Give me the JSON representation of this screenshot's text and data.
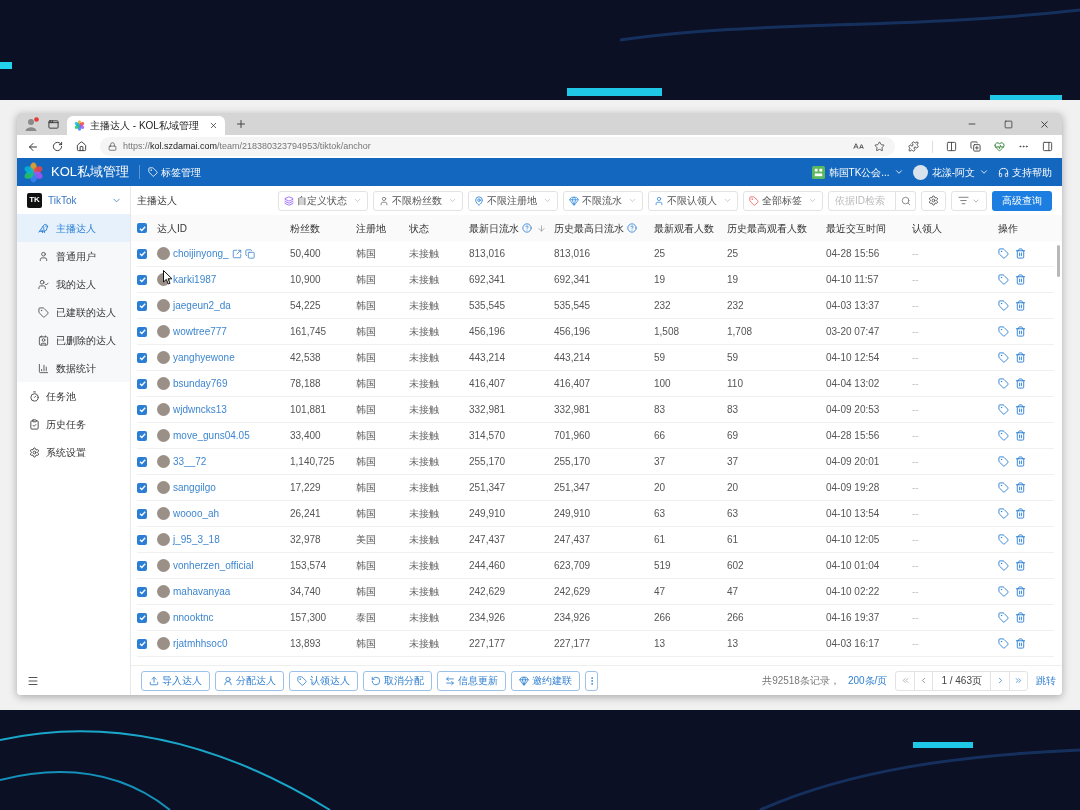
{
  "browser": {
    "tab": {
      "title": "主播达人 - KOL私域管理"
    },
    "url": {
      "scheme": "https://",
      "host": "kol.szdamai.com",
      "path": "/team/218380323794953/tiktok/anchor"
    }
  },
  "app_header": {
    "brand": "KOL私域管理",
    "nav_link": "标签管理",
    "team": "韩国TK公会...",
    "user": "花漾-阿文",
    "help": "支持帮助"
  },
  "sidebar": {
    "menu": [
      {
        "kind": "group",
        "logo": "TK",
        "label": "TikTok",
        "expanded": true,
        "children": [
          {
            "label": "主播达人",
            "selected": true
          },
          {
            "label": "普通用户",
            "selected": false
          },
          {
            "label": "我的达人",
            "selected": false
          },
          {
            "label": "已建联的达人",
            "selected": false
          },
          {
            "label": "已删除的达人",
            "selected": false
          },
          {
            "label": "数据统计",
            "selected": false
          }
        ]
      },
      {
        "kind": "item",
        "label": "任务池",
        "selected": false
      },
      {
        "kind": "item",
        "label": "历史任务",
        "selected": false
      },
      {
        "kind": "item",
        "label": "系统设置",
        "selected": false
      }
    ]
  },
  "toolbar": {
    "title": "主播达人",
    "filters": [
      {
        "label": "自定义状态"
      },
      {
        "label": "不限粉丝数"
      },
      {
        "label": "不限注册地"
      },
      {
        "label": "不限流水"
      },
      {
        "label": "不限认领人"
      },
      {
        "label": "全部标签"
      }
    ],
    "search": {
      "placeholder": "依据ID检索"
    },
    "advanced_button": "高级查询"
  },
  "table": {
    "all_selected": true,
    "columns": [
      {
        "label": "达人ID",
        "help": false,
        "sorted": false
      },
      {
        "label": "粉丝数",
        "help": false,
        "sorted": false
      },
      {
        "label": "注册地",
        "help": false,
        "sorted": false
      },
      {
        "label": "状态",
        "help": false,
        "sorted": false
      },
      {
        "label": "最新日流水",
        "help": true,
        "sorted": true
      },
      {
        "label": "历史最高日流水",
        "help": true,
        "sorted": false
      },
      {
        "label": "最新观看人数",
        "help": false,
        "sorted": false
      },
      {
        "label": "历史最高观看人数",
        "help": false,
        "sorted": false
      },
      {
        "label": "最近交互时间",
        "help": false,
        "sorted": false
      },
      {
        "label": "认领人",
        "help": false,
        "sorted": false
      },
      {
        "label": "操作",
        "help": false,
        "sorted": false
      }
    ],
    "rows": [
      {
        "selected": true,
        "name": "choijinyong_",
        "actions_visible": true,
        "fans": "50,400",
        "region": "韩国",
        "status": "未接触",
        "latest_flow": "813,016",
        "peak_flow": "813,016",
        "latest_viewers": "25",
        "peak_viewers": "25",
        "last_interaction": "04-28 15:56",
        "claimant": "--"
      },
      {
        "selected": true,
        "name": "karki1987",
        "actions_visible": false,
        "fans": "10,900",
        "region": "韩国",
        "status": "未接触",
        "latest_flow": "692,341",
        "peak_flow": "692,341",
        "latest_viewers": "19",
        "peak_viewers": "19",
        "last_interaction": "04-10 11:57",
        "claimant": "--"
      },
      {
        "selected": true,
        "name": "jaegeun2_da",
        "actions_visible": false,
        "fans": "54,225",
        "region": "韩国",
        "status": "未接触",
        "latest_flow": "535,545",
        "peak_flow": "535,545",
        "latest_viewers": "232",
        "peak_viewers": "232",
        "last_interaction": "04-03 13:37",
        "claimant": "--"
      },
      {
        "selected": true,
        "name": "wowtree777",
        "actions_visible": false,
        "fans": "161,745",
        "region": "韩国",
        "status": "未接触",
        "latest_flow": "456,196",
        "peak_flow": "456,196",
        "latest_viewers": "1,508",
        "peak_viewers": "1,708",
        "last_interaction": "03-20 07:47",
        "claimant": "--"
      },
      {
        "selected": true,
        "name": "yanghyewone",
        "actions_visible": false,
        "fans": "42,538",
        "region": "韩国",
        "status": "未接触",
        "latest_flow": "443,214",
        "peak_flow": "443,214",
        "latest_viewers": "59",
        "peak_viewers": "59",
        "last_interaction": "04-10 12:54",
        "claimant": "--"
      },
      {
        "selected": true,
        "name": "bsunday769",
        "actions_visible": false,
        "fans": "78,188",
        "region": "韩国",
        "status": "未接触",
        "latest_flow": "416,407",
        "peak_flow": "416,407",
        "latest_viewers": "100",
        "peak_viewers": "110",
        "last_interaction": "04-04 13:02",
        "claimant": "--"
      },
      {
        "selected": true,
        "name": "wjdwncks13",
        "actions_visible": false,
        "fans": "101,881",
        "region": "韩国",
        "status": "未接触",
        "latest_flow": "332,981",
        "peak_flow": "332,981",
        "latest_viewers": "83",
        "peak_viewers": "83",
        "last_interaction": "04-09 20:53",
        "claimant": "--"
      },
      {
        "selected": true,
        "name": "move_guns04.05",
        "actions_visible": false,
        "fans": "33,400",
        "region": "韩国",
        "status": "未接触",
        "latest_flow": "314,570",
        "peak_flow": "701,960",
        "latest_viewers": "66",
        "peak_viewers": "69",
        "last_interaction": "04-28 15:56",
        "claimant": "--"
      },
      {
        "selected": true,
        "name": "33__72",
        "actions_visible": false,
        "fans": "1,140,725",
        "region": "韩国",
        "status": "未接触",
        "latest_flow": "255,170",
        "peak_flow": "255,170",
        "latest_viewers": "37",
        "peak_viewers": "37",
        "last_interaction": "04-09 20:01",
        "claimant": "--"
      },
      {
        "selected": true,
        "name": "sanggilgo",
        "actions_visible": false,
        "fans": "17,229",
        "region": "韩国",
        "status": "未接触",
        "latest_flow": "251,347",
        "peak_flow": "251,347",
        "latest_viewers": "20",
        "peak_viewers": "20",
        "last_interaction": "04-09 19:28",
        "claimant": "--"
      },
      {
        "selected": true,
        "name": "woooo_ah",
        "actions_visible": false,
        "fans": "26,241",
        "region": "韩国",
        "status": "未接触",
        "latest_flow": "249,910",
        "peak_flow": "249,910",
        "latest_viewers": "63",
        "peak_viewers": "63",
        "last_interaction": "04-10 13:54",
        "claimant": "--"
      },
      {
        "selected": true,
        "name": "j_95_3_18",
        "actions_visible": false,
        "fans": "32,978",
        "region": "美国",
        "status": "未接触",
        "latest_flow": "247,437",
        "peak_flow": "247,437",
        "latest_viewers": "61",
        "peak_viewers": "61",
        "last_interaction": "04-10 12:05",
        "claimant": "--"
      },
      {
        "selected": true,
        "name": "vonherzen_official",
        "actions_visible": false,
        "fans": "153,574",
        "region": "韩国",
        "status": "未接触",
        "latest_flow": "244,460",
        "peak_flow": "623,709",
        "latest_viewers": "519",
        "peak_viewers": "602",
        "last_interaction": "04-10 01:04",
        "claimant": "--"
      },
      {
        "selected": true,
        "name": "mahavanyaa",
        "actions_visible": false,
        "fans": "34,740",
        "region": "韩国",
        "status": "未接触",
        "latest_flow": "242,629",
        "peak_flow": "242,629",
        "latest_viewers": "47",
        "peak_viewers": "47",
        "last_interaction": "04-10 02:22",
        "claimant": "--"
      },
      {
        "selected": true,
        "name": "nnooktnc",
        "actions_visible": false,
        "fans": "157,300",
        "region": "泰国",
        "status": "未接触",
        "latest_flow": "234,926",
        "peak_flow": "234,926",
        "latest_viewers": "266",
        "peak_viewers": "266",
        "last_interaction": "04-16 19:37",
        "claimant": "--"
      },
      {
        "selected": true,
        "name": "rjatmhhsoc0",
        "actions_visible": false,
        "fans": "13,893",
        "region": "韩国",
        "status": "未接触",
        "latest_flow": "227,177",
        "peak_flow": "227,177",
        "latest_viewers": "13",
        "peak_viewers": "13",
        "last_interaction": "04-03 16:17",
        "claimant": "--"
      }
    ]
  },
  "bottom_bar": {
    "actions": [
      {
        "label": "导入达人"
      },
      {
        "label": "分配达人"
      },
      {
        "label": "认领达人"
      },
      {
        "label": "取消分配"
      },
      {
        "label": "信息更新"
      },
      {
        "label": "邀约建联"
      }
    ],
    "pagination": {
      "total": "共92518条记录，",
      "page_size": "200条/页",
      "page": "1 / 463页",
      "jump": "跳转"
    }
  }
}
